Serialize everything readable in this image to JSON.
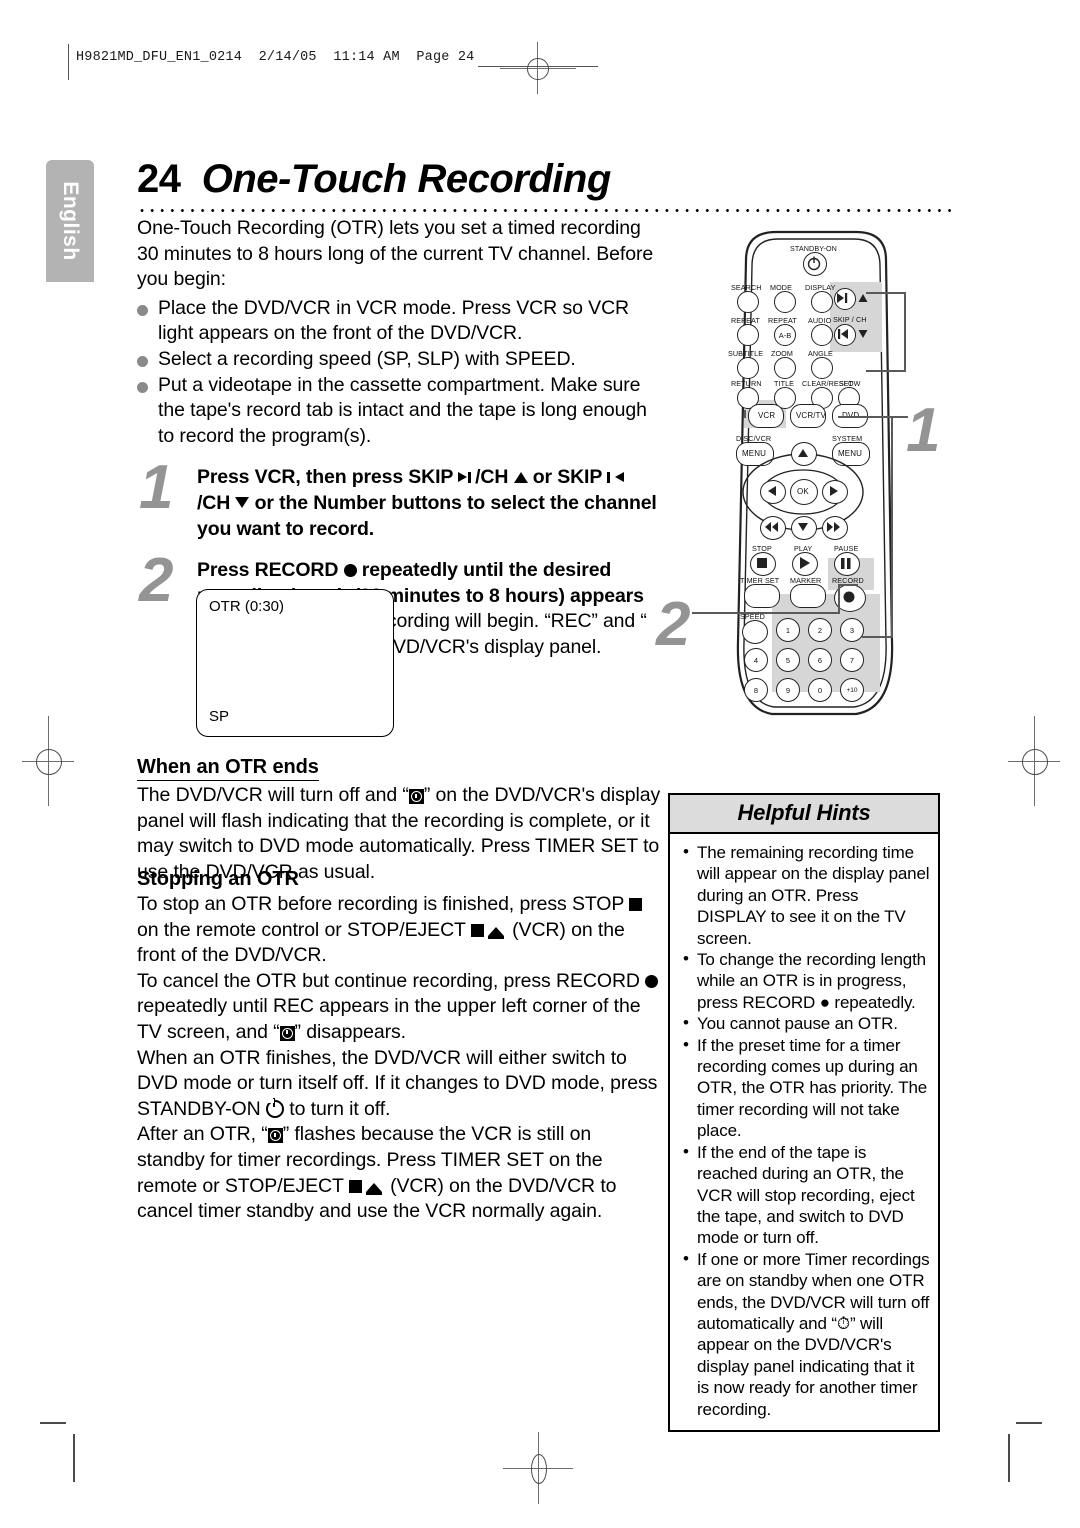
{
  "print_slug": "H9821MD_DFU_EN1_0214  2/14/05  11:14 AM  Page 24",
  "side_tab": {
    "label": "English"
  },
  "page": {
    "number": "24",
    "title": "One-Touch Recording"
  },
  "intro": "One-Touch Recording (OTR) lets you set a timed recording 30 minutes to 8 hours long of the current TV channel. Before you begin:",
  "prereq_bullets": [
    "Place the DVD/VCR in VCR mode. Press VCR so VCR light appears on the front of the DVD/VCR.",
    "Select a recording speed (SP, SLP) with SPEED.",
    "Put a videotape in the cassette compartment. Make sure the tape's record tab is intact and the tape is long enough to record the program(s)."
  ],
  "steps": [
    {
      "number": "1",
      "part1": "Press VCR, then press SKIP ",
      "part2": "/CH ",
      "part3": " or SKIP ",
      "part4": "/CH ",
      "part5": " or the Number buttons to select the channel you want to record."
    },
    {
      "number": "2",
      "bold1": "Press RECORD ",
      "bold2": " repeatedly until the desired recording length (30 minutes to 8 hours) appears on the TV screen.",
      "normal1": " Recording will begin. “REC” and “",
      "normal2": "” will appear on the DVD/VCR's display panel."
    }
  ],
  "tv_screen": {
    "otr_label": "OTR (0:30)",
    "speed_label": "SP"
  },
  "when_otr_ends": {
    "heading": "When an OTR ends",
    "text1": "The DVD/VCR will turn off and “",
    "text2": "” on the DVD/VCR's display panel will flash indicating that the recording is complete, or it may switch to DVD mode automatically. Press TIMER SET to use the DVD/VCR as usual."
  },
  "stopping_otr": {
    "heading": "Stopping an OTR",
    "p1a": "To stop an OTR before recording is finished, press STOP ",
    "p1b": " on the remote control or STOP/EJECT ",
    "p1c": " (VCR) on the front of the DVD/VCR.",
    "p2a": "To cancel the OTR but continue recording, press RECORD ",
    "p2b": " repeatedly until REC appears in the upper left corner of the TV screen, and “",
    "p2c": "” disappears.",
    "p3a": "When an OTR finishes, the DVD/VCR will either switch to DVD mode or turn itself off. If it changes to DVD mode, press STANDBY-ON ",
    "p3b": " to turn it off.",
    "p4a": "After an OTR, “",
    "p4b": "” flashes because the VCR is still on standby for timer recordings. Press TIMER SET on the remote or STOP/EJECT ",
    "p4c": " (VCR) on the DVD/VCR to cancel timer standby and use the VCR normally again."
  },
  "helpful_hints": {
    "title": "Helpful Hints",
    "items": [
      "The remaining recording time will appear on the display panel during an OTR. Press DISPLAY to see it on the TV screen.",
      "To change the recording length while an OTR is in progress, press RECORD ● repeatedly.",
      "You cannot pause an OTR.",
      "If the preset time for a timer recording comes up during an OTR, the OTR has priority. The timer recording will not take place.",
      "If the end of the tape is reached during an OTR, the VCR will stop recording, eject the tape, and switch to DVD mode or turn off.",
      "If one or more Timer recordings are on standby when one OTR ends, the DVD/VCR will turn off automatically and “⏱” will appear on the DVD/VCR's display panel indicating that it is now ready for another timer recording."
    ],
    "bullet_char": "•"
  },
  "remote": {
    "callout_1": "1",
    "callout_2": "2",
    "standby_label": "STANDBY-ON",
    "row1": [
      "SEARCH",
      "MODE",
      "DISPLAY"
    ],
    "row2": [
      "REPEAT",
      "REPEAT",
      "AUDIO"
    ],
    "repeat_ab_text": "A-B",
    "row3": [
      "SUBTITLE",
      "ZOOM",
      "ANGLE"
    ],
    "row4": [
      "RETURN",
      "TITLE",
      "CLEAR/RESET",
      "SLOW"
    ],
    "skip_ch_label": "SKIP / CH",
    "mode_buttons": [
      "VCR",
      "VCR/TV",
      "DVD"
    ],
    "menu_left_label": "DISC/VCR",
    "menu_right_label": "SYSTEM",
    "menu_text": "MENU",
    "ok_text": "OK",
    "transport_labels": [
      "STOP",
      "PLAY",
      "PAUSE"
    ],
    "func_labels": [
      "TIMER SET",
      "MARKER",
      "RECORD"
    ],
    "speed_label": "SPEED",
    "numbers": [
      "1",
      "2",
      "3",
      "4",
      "5",
      "6",
      "7",
      "8",
      "9",
      "0",
      "+10"
    ]
  }
}
